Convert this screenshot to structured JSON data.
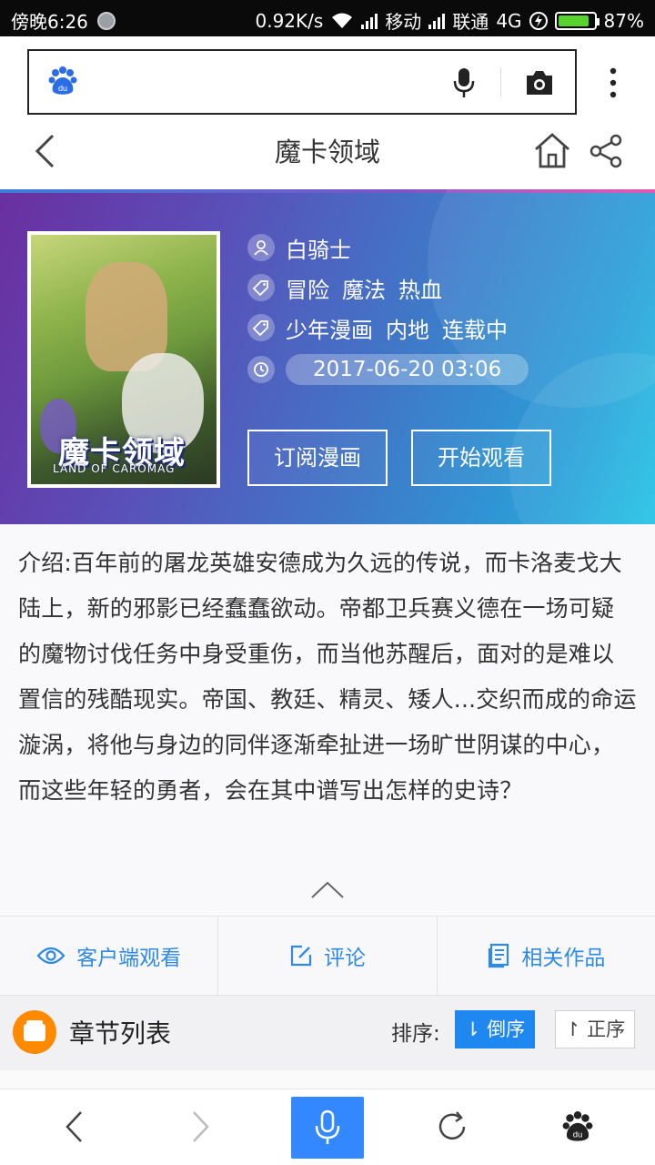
{
  "status_bar": {
    "time": "傍晚6:26",
    "speed": "0.92K/s",
    "carrier1": "移动",
    "carrier2": "联通",
    "network": "4G",
    "battery": "87%",
    "battery_level": 0.87
  },
  "search": {
    "placeholder": "",
    "logo_icon": "baidu-paw-icon"
  },
  "header": {
    "title": "魔卡领域"
  },
  "comic": {
    "cover_title": "魔卡领域",
    "cover_subtitle": "LAND OF CAROMAG",
    "author": "白骑士",
    "genres": [
      "冒险",
      "魔法",
      "热血"
    ],
    "categories": [
      "少年漫画",
      "内地",
      "连载中"
    ],
    "updated": "2017-06-20 03:06",
    "subscribe_label": "订阅漫画",
    "start_label": "开始观看"
  },
  "intro": {
    "text": "介绍:百年前的屠龙英雄安德成为久远的传说，而卡洛麦戈大陆上，新的邪影已经蠢蠢欲动。帝都卫兵赛义德在一场可疑的魔物讨伐任务中身受重伤，而当他苏醒后，面对的是难以置信的残酷现实。帝国、教廷、精灵、矮人...交织而成的命运漩涡，将他与身边的同伴逐渐牵扯进一场旷世阴谋的中心，而这些年轻的勇者，会在其中谱写出怎样的史诗？"
  },
  "actions": {
    "client_label": "客户端观看",
    "comment_label": "评论",
    "related_label": "相关作品"
  },
  "chapters": {
    "title": "章节列表",
    "sort_label": "排序:",
    "desc_label": "倒序",
    "asc_label": "正序"
  },
  "colors": {
    "accent": "#2f8ae5",
    "sort_active": "#1e87f0",
    "mic_button": "#3388ff",
    "chapter_icon": "#ff8a00"
  }
}
